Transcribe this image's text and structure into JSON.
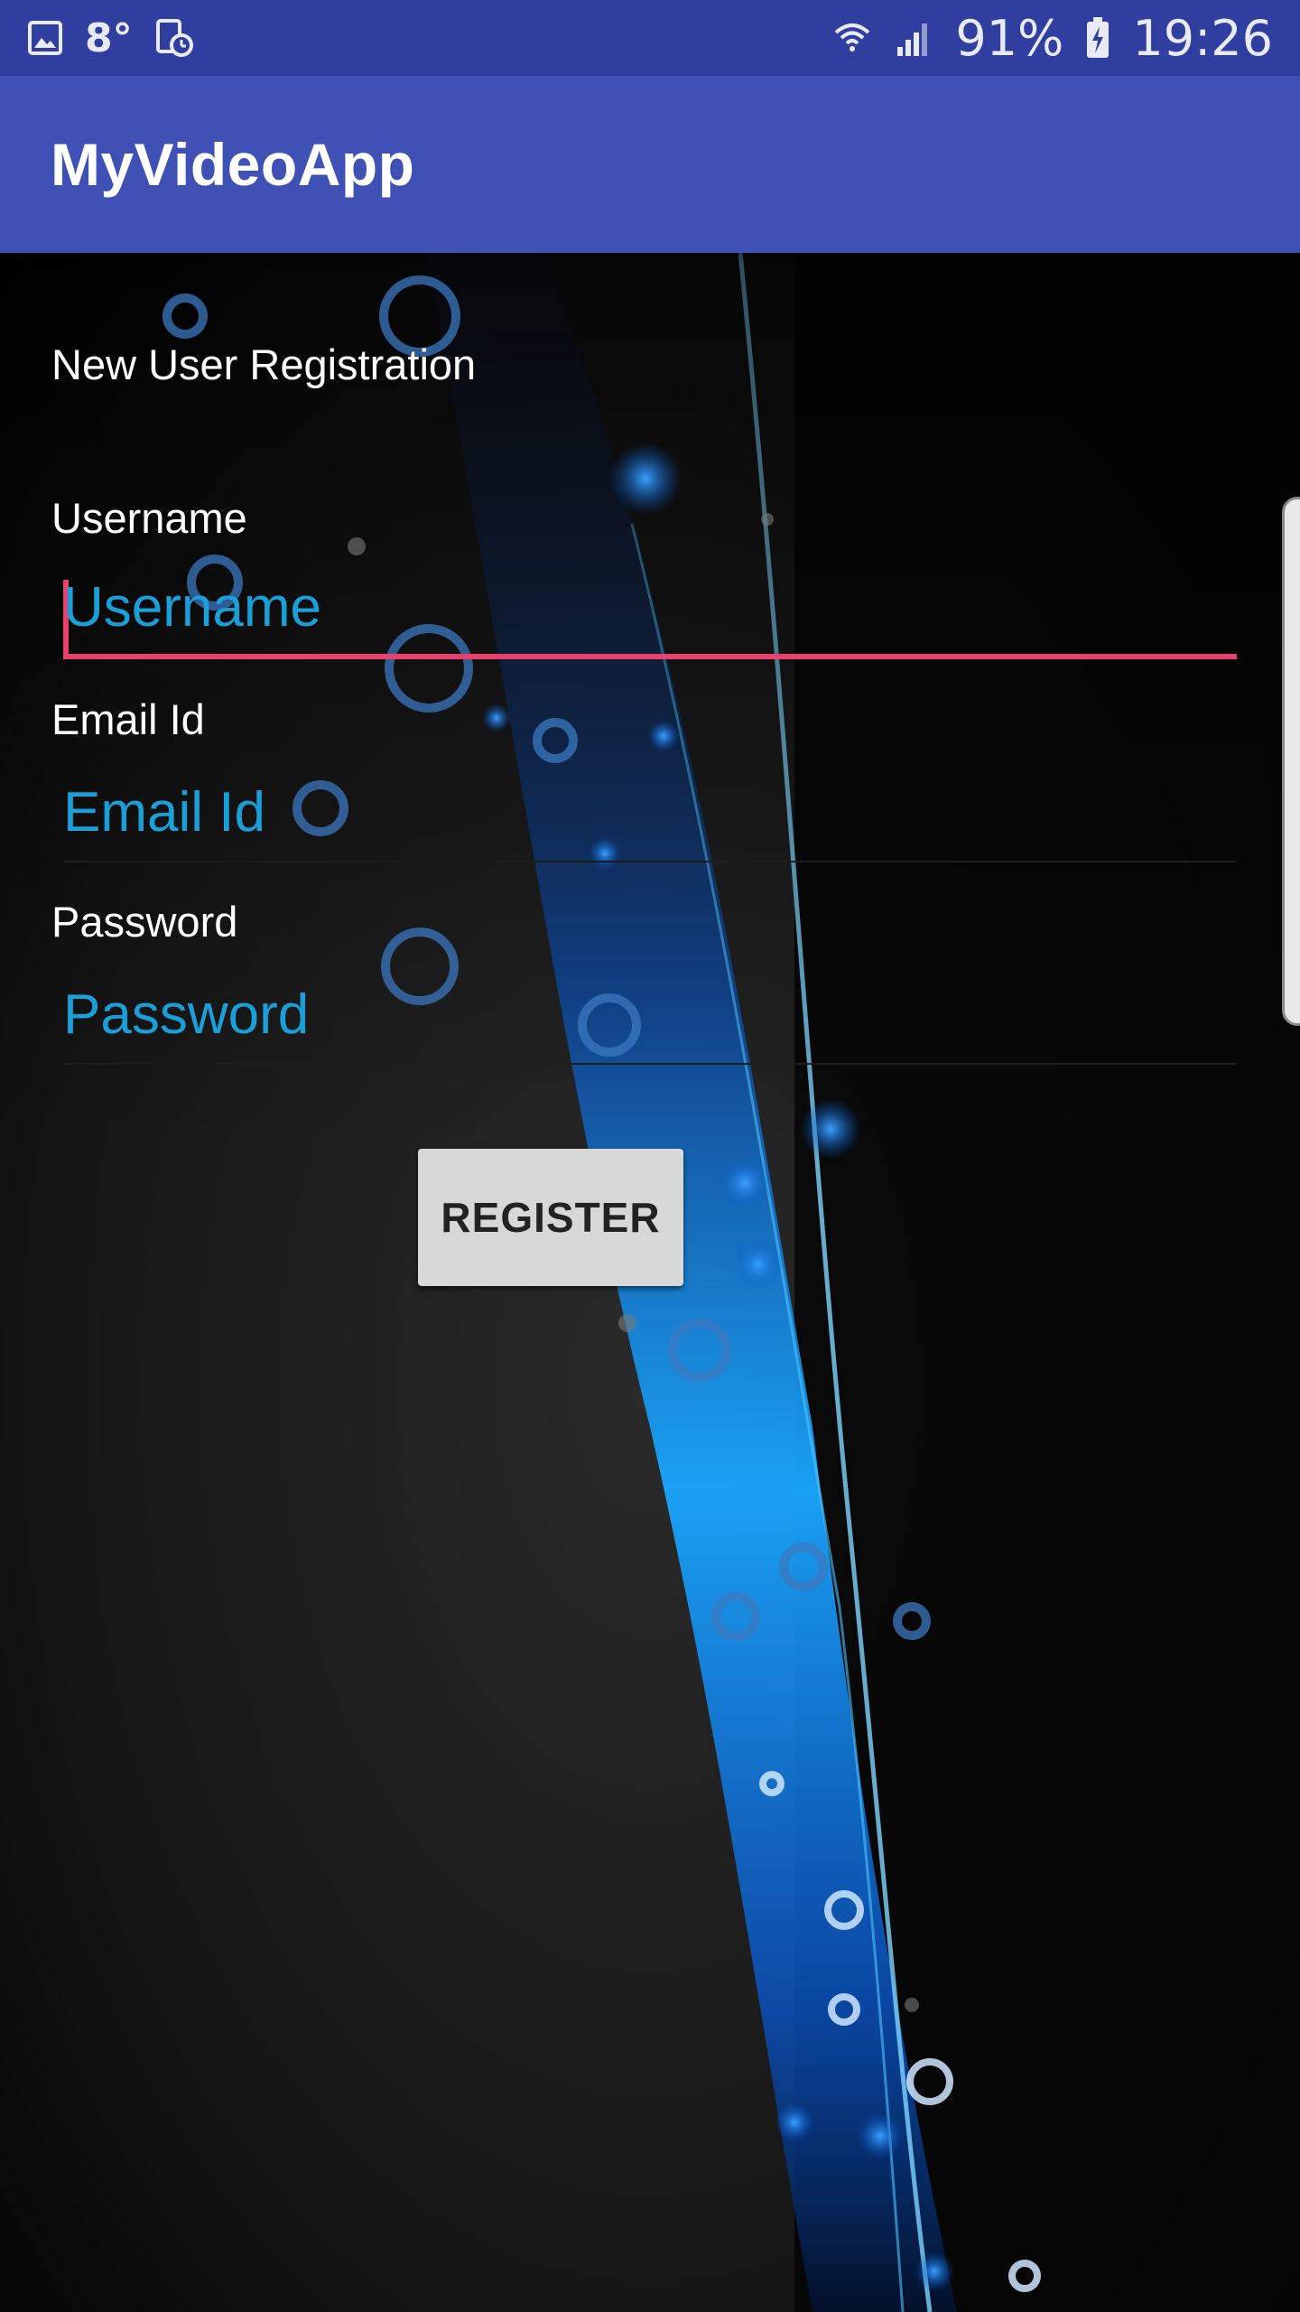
{
  "status_bar": {
    "temperature": "8°",
    "battery_percent": "91%",
    "time": "19:26",
    "icons": [
      "gallery-icon",
      "clock-update-icon",
      "wifi-icon",
      "signal-icon",
      "battery-charging-icon"
    ]
  },
  "app_bar": {
    "title": "MyVideoApp",
    "color": "#3f51b5"
  },
  "form": {
    "heading": "New User Registration",
    "username": {
      "label": "Username",
      "placeholder": "Username",
      "value": ""
    },
    "email": {
      "label": "Email Id",
      "placeholder": "Email Id",
      "value": ""
    },
    "password": {
      "label": "Password",
      "placeholder": "Password",
      "value": ""
    },
    "register_label": "REGISTER"
  },
  "colors": {
    "accent": "#e8416e",
    "hint_text": "#1a9fd8",
    "status_bar": "#303f9f",
    "button": "#d6d7d7"
  }
}
